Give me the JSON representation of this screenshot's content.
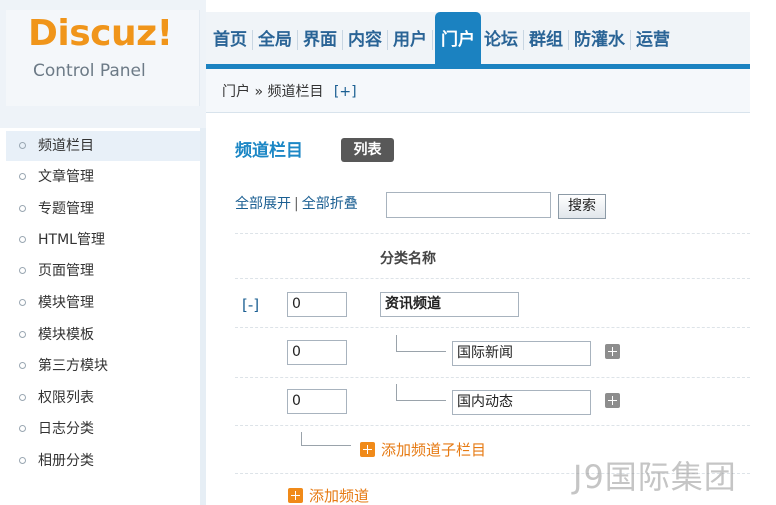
{
  "brand": {
    "logo": "Discuz!",
    "subtitle": "Control Panel"
  },
  "topnav": {
    "items": [
      "首页",
      "全局",
      "界面",
      "内容",
      "用户",
      "门户",
      "论坛",
      "群组",
      "防灌水",
      "运营"
    ],
    "active": "门户"
  },
  "breadcrumb": {
    "text": "门户 » 频道栏目",
    "plus": "[+]"
  },
  "sidebar": {
    "items": [
      "频道栏目",
      "文章管理",
      "专题管理",
      "HTML管理",
      "页面管理",
      "模块管理",
      "模块模板",
      "第三方模块",
      "权限列表",
      "日志分类",
      "相册分类"
    ],
    "active": "频道栏目"
  },
  "main": {
    "title": "频道栏目",
    "tab_label": "列表",
    "expand_all": "全部展开",
    "separator": "|",
    "collapse_all": "全部折叠",
    "search_value": "",
    "search_button": "搜索",
    "column_header": "分类名称",
    "toggle": "[-]",
    "rows": [
      {
        "order": "0",
        "name": "资讯频道"
      },
      {
        "order": "0",
        "name": "国际新闻"
      },
      {
        "order": "0",
        "name": "国内动态"
      }
    ],
    "add_sub_label": "添加频道子栏目",
    "add_channel_label": "添加频道"
  },
  "watermark": "J9国际集团",
  "colors": {
    "accent": "#1b82c1",
    "logo": "#f0951a",
    "add_link": "#e67a13",
    "link": "#1b5f92"
  }
}
